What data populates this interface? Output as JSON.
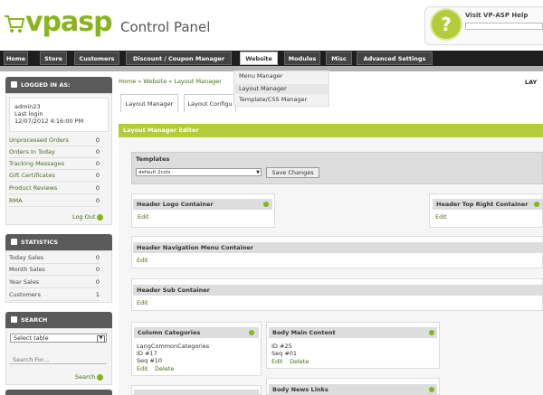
{
  "header": {
    "logo_text": "vpasp",
    "title": "Control Panel",
    "help": {
      "label": "Visit VP-ASP Help",
      "input_value": ""
    }
  },
  "nav": {
    "tabs": [
      "Home",
      "Store",
      "Customers",
      "Discount / Coupon Manager",
      "Website",
      "Modules",
      "Misc",
      "Advanced Settings"
    ],
    "active": "Website"
  },
  "dropdown": {
    "items": [
      "Menu Manager",
      "Layout Manager",
      "Template/CSS Manager"
    ]
  },
  "sidebar": {
    "logged_in": {
      "heading": "LOGGED IN AS:",
      "user": "admin23",
      "last_login_label": "Last login",
      "last_login": "12/07/2012 4:16:00 PM",
      "rows": [
        {
          "label": "Unprocessed Orders",
          "value": "0"
        },
        {
          "label": "Orders In Today",
          "value": "0"
        },
        {
          "label": "Tracking Messages",
          "value": "0"
        },
        {
          "label": "Gift Certificates",
          "value": "0"
        },
        {
          "label": "Product Reviews",
          "value": "0"
        },
        {
          "label": "RMA",
          "value": "0"
        }
      ],
      "logout": "Log Out"
    },
    "statistics": {
      "heading": "STATISTICS",
      "rows": [
        {
          "label": "Today Sales",
          "value": "0"
        },
        {
          "label": "Month Sales",
          "value": "0"
        },
        {
          "label": "Year Sales",
          "value": "0"
        },
        {
          "label": "Customers",
          "value": "1"
        }
      ]
    },
    "search": {
      "heading": "SEARCH",
      "select_value": "Select table",
      "input_placeholder": "Search For...",
      "button": "Search"
    }
  },
  "main": {
    "breadcrumb": "Home » Website » Layout Manager",
    "right_label": "LAY",
    "subtabs": [
      "Layout Manager",
      "Layout Configu"
    ],
    "editor_title": "Layout Manager Editor",
    "templates": {
      "label": "Templates",
      "selected": "default 2cols",
      "save_button": "Save Changes"
    },
    "containers": {
      "header_logo": {
        "title": "Header Logo Container",
        "link": "Edit"
      },
      "header_top_right": {
        "title": "Header Top Right Container",
        "link": "Edit"
      },
      "header_nav": {
        "title": "Header Navigation Menu Container",
        "link": "Edit"
      },
      "header_sub": {
        "title": "Header Sub Container",
        "link": "Edit"
      },
      "column_categories": {
        "title": "Column Categories",
        "name": "LangCommonCategories",
        "id": "ID #17",
        "seq": "Seq #10",
        "edit": "Edit",
        "delete": "Delete"
      },
      "body_main": {
        "title": "Body Main Content",
        "id": "ID #25",
        "seq": "Seq #01",
        "edit": "Edit",
        "delete": "Delete"
      },
      "body_news": {
        "title": "Body News Links"
      }
    }
  },
  "colors": {
    "accent": "#8ab51a",
    "nav_bg": "#1e1e1e",
    "editor_bar": "#b5cc3a"
  }
}
